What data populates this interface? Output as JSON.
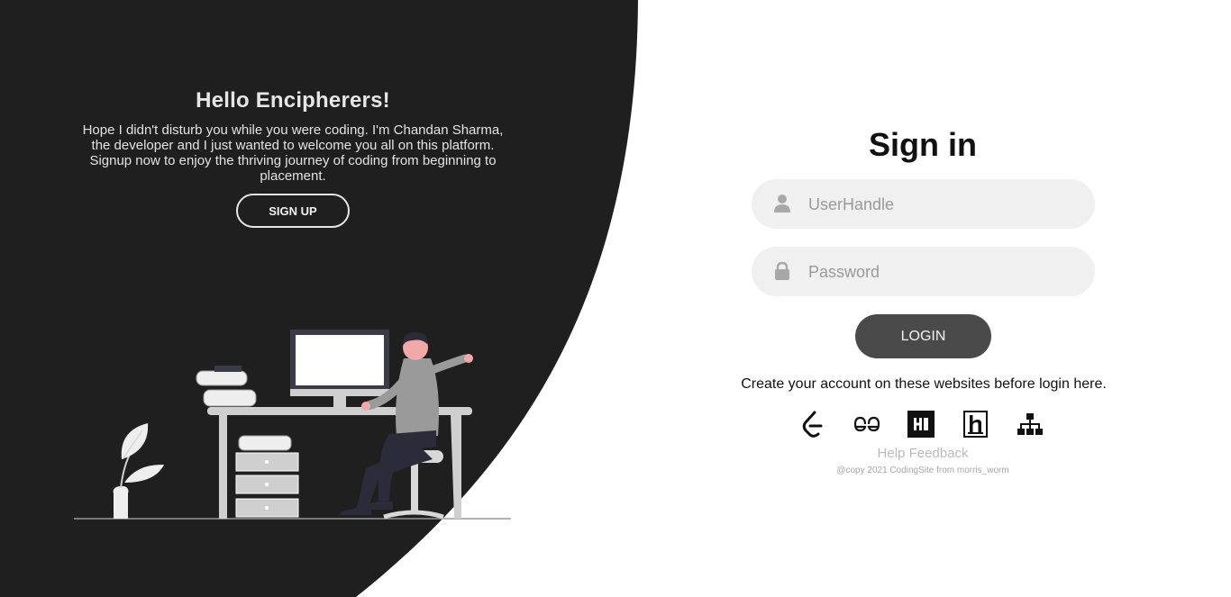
{
  "left": {
    "title": "Hello Encipherers!",
    "message": "Hope I didn't disturb you while you were coding. I'm Chandan Sharma, the developer and I just wanted to welcome you all on this platform. Signup now to enjoy the thriving journey of coding from beginning to placement.",
    "signup_label": "SIGN UP"
  },
  "signin": {
    "title": "Sign in",
    "username_placeholder": "UserHandle",
    "password_placeholder": "Password",
    "login_label": "LOGIN",
    "create_account_text": "Create your account on these websites before login here.",
    "sites": [
      "leetcode-icon",
      "geeksforgeeks-icon",
      "hackerrank-icon",
      "hackerearth-icon",
      "sitemap-icon"
    ],
    "help_label": "Help Feedback",
    "copyright": "@copy 2021 CodingSite from morris_worm"
  },
  "colors": {
    "dark_panel": "#1f1f1f",
    "field_bg": "#f0f0f0",
    "login_button": "#4a4a4a"
  }
}
